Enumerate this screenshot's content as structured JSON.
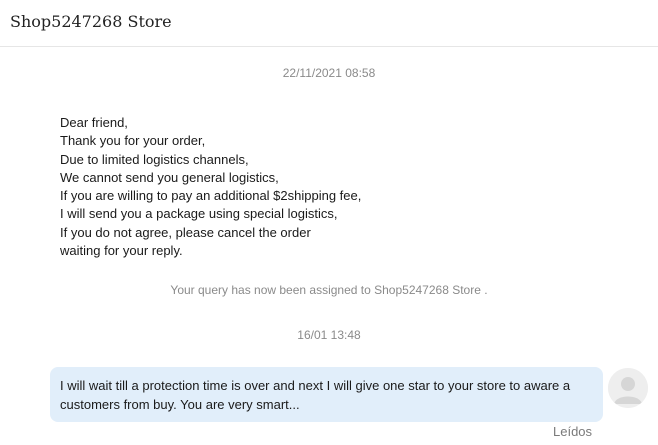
{
  "header": {
    "title": "Shop5247268 Store"
  },
  "conversation": {
    "first_timestamp": "22/11/2021 08:58",
    "seller_message_lines": [
      "Dear friend,",
      "Thank you for your order,",
      "Due to limited logistics channels,",
      "We cannot send you general logistics,",
      "If you are willing to pay an additional $2shipping fee,",
      "I will send you a package using special logistics,",
      "If you do not agree, please cancel the order",
      "waiting for your reply."
    ],
    "system_note": "Your query has now been assigned to Shop5247268 Store .",
    "second_timestamp": "16/01 13:48",
    "user_message": "I will wait till a protection time is over and next I will give one star to your store to aware a customers from buy. You are very smart...",
    "read_status": "Leídos"
  },
  "colors": {
    "user_bubble": "#e1eefa",
    "muted_text": "#8a8a8a"
  },
  "icons": {
    "avatar": "user-avatar-icon"
  }
}
